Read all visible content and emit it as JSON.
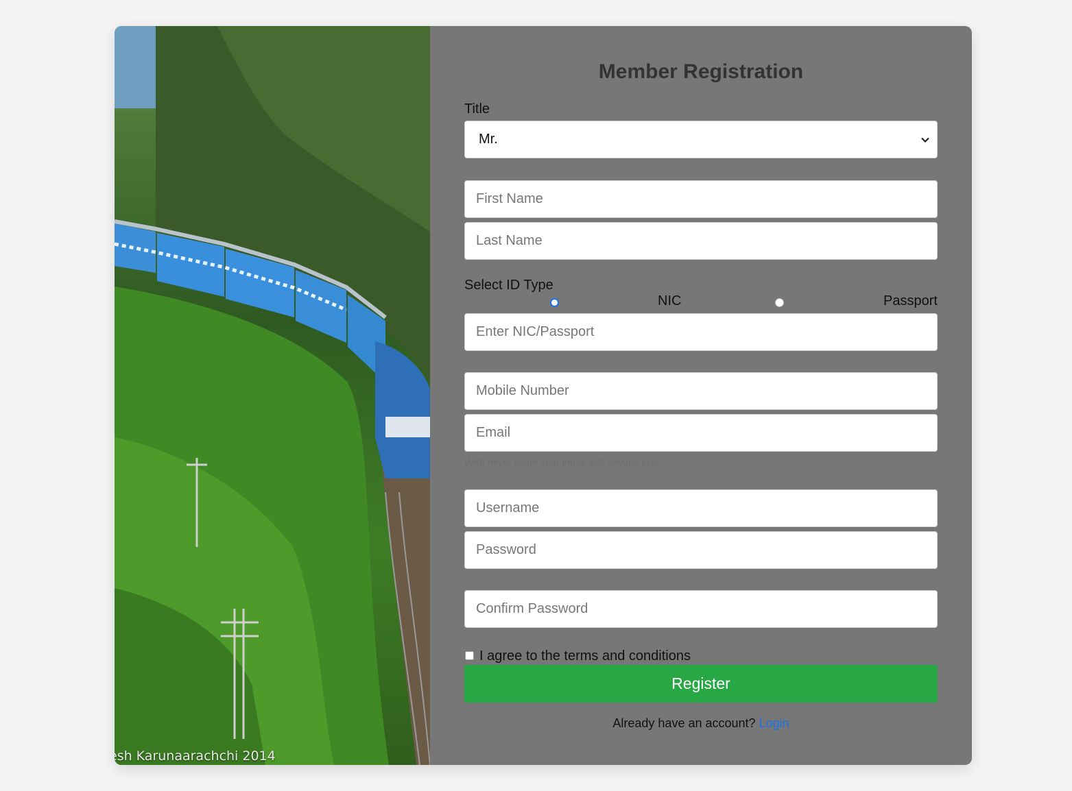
{
  "photo": {
    "credit": "esh Karunaarachchi 2014"
  },
  "form": {
    "heading": "Member Registration",
    "title_label": "Title",
    "title_value": "Mr.",
    "first_name_placeholder": "First Name",
    "last_name_placeholder": "Last Name",
    "id_type_label": "Select ID Type",
    "id_options": [
      {
        "label": "NIC",
        "checked": true
      },
      {
        "label": "Passport",
        "checked": false
      }
    ],
    "id_number_placeholder": "Enter NIC/Passport",
    "mobile_placeholder": "Mobile Number",
    "email_placeholder": "Email",
    "email_hint": "We'll never share your email with anyone else.",
    "username_placeholder": "Username",
    "password_placeholder": "Password",
    "confirm_password_placeholder": "Confirm Password",
    "agree_label": "I agree to the terms and conditions",
    "register_label": "Register",
    "footer_text": "Already have an account?",
    "login_link": "Login"
  },
  "colors": {
    "panel": "#777777",
    "register": "#28a745",
    "link": "#1a73e8"
  }
}
